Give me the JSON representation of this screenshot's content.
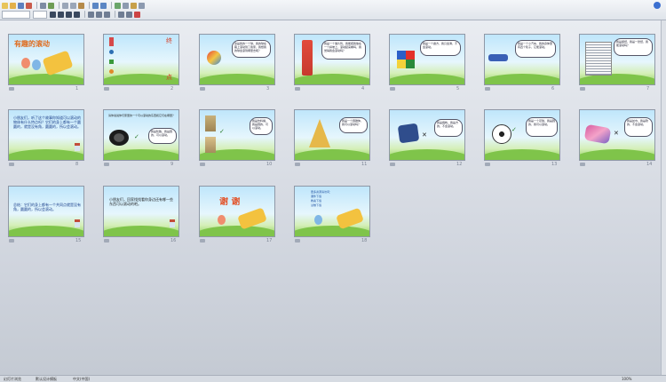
{
  "toolbar": {
    "font_name": "",
    "font_size": ""
  },
  "slides": [
    {
      "num": "1",
      "title": "有趣的滚动",
      "kind": "cover"
    },
    {
      "num": "2",
      "kind": "rolling",
      "labels": [
        "终",
        "点"
      ]
    },
    {
      "num": "3",
      "kind": "ball",
      "bubble": "这是我的一个球，我的球在路上滚动到了我家，我想我的球会滚到哪里去呢？"
    },
    {
      "num": "4",
      "kind": "can",
      "bubble": "我是一个薯片筒，我能把我放在一个斜坡上，滚动起来看吗，我觉得我会滚动吗？"
    },
    {
      "num": "5",
      "kind": "cube",
      "bubble": "我是一个魔方，我只会滑，不会滚动。"
    },
    {
      "num": "6",
      "kind": "car",
      "bubble": "我是一个小汽车，我的身体里有四个轮子，它能滚动。"
    },
    {
      "num": "7",
      "kind": "newspaper",
      "bubble": "我是报纸，我是一张纸，我能滚动吗？"
    },
    {
      "num": "8",
      "kind": "text",
      "text": "小朋友们，听了这个故事你知道可以滚动的物体有什么特点吗？它们的身上都有一个圆圆的，就是没有角，圆圆的，所以会滚动。"
    },
    {
      "num": "9",
      "kind": "tire",
      "text": "请你说说你们家里的一个可以滚动的东西和它们在哪里？",
      "bubble": "我是轮胎，我是圆的，可以滚动。"
    },
    {
      "num": "10",
      "kind": "cans",
      "bubble": "我是饮料罐，我是圆的，可以滚动。"
    },
    {
      "num": "11",
      "kind": "cone",
      "bubble": "我是一个圆锥体，我可以滚动吗？"
    },
    {
      "num": "12",
      "kind": "pillow",
      "bubble": "我是抱枕，我是方的，不会滚动。"
    },
    {
      "num": "13",
      "kind": "football",
      "bubble": "我是一个足球，我是圆的，我可以滚动。"
    },
    {
      "num": "14",
      "kind": "cloth",
      "bubble": "我是丝巾，我是软的，不会滚动。"
    },
    {
      "num": "15",
      "kind": "text",
      "text": "总结：它们的身上都有一个共同点就是没有角，圆圆的，所以会滚动。"
    },
    {
      "num": "16",
      "kind": "text",
      "text": "小朋友们，回家找找看你身边还有哪一些东西可以滚动的吧。"
    },
    {
      "num": "17",
      "kind": "thanks",
      "title": "谢 谢"
    },
    {
      "num": "18",
      "kind": "links",
      "lines": [
        "更多资源请访问：",
        "课件下载",
        "教案下载",
        "试卷下载"
      ]
    }
  ],
  "status": {
    "slide_sorter": "幻灯片浏览",
    "theme": "默认设计模板",
    "language": "中文(中国)",
    "zoom": "100%"
  }
}
